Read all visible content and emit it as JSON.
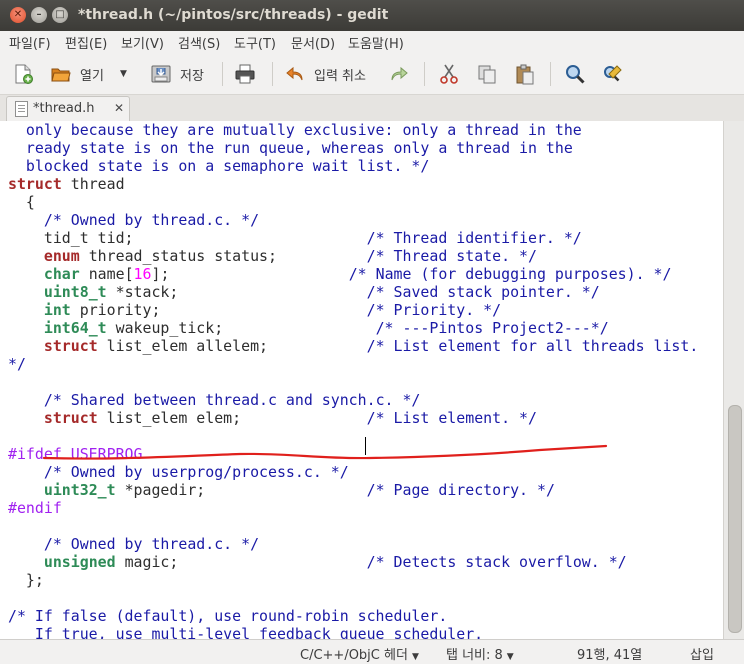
{
  "window": {
    "title": "*thread.h (~/pintos/src/threads) - gedit"
  },
  "menu": [
    "파일(F)",
    "편집(E)",
    "보기(V)",
    "검색(S)",
    "도구(T)",
    "문서(D)",
    "도움말(H)"
  ],
  "toolbar": {
    "open_label": "열기",
    "save_label": "저장",
    "undo_label": "입력 취소"
  },
  "tab": {
    "label": "*thread.h"
  },
  "code": [
    [
      [
        "c",
        "  only because they are mutually exclusive: only a thread in the"
      ]
    ],
    [
      [
        "c",
        "  ready state is on the run queue, whereas only a thread in the"
      ]
    ],
    [
      [
        "c",
        "  blocked state is on a semaphore wait list. */"
      ]
    ],
    [
      [
        "k",
        "struct"
      ],
      [
        "p",
        " thread"
      ]
    ],
    [
      [
        "p",
        "  {"
      ]
    ],
    [
      [
        "p",
        "    "
      ],
      [
        "c",
        "/* Owned by thread.c. */"
      ]
    ],
    [
      [
        "p",
        "    tid_t tid;                          "
      ],
      [
        "c",
        "/* Thread identifier. */"
      ]
    ],
    [
      [
        "p",
        "    "
      ],
      [
        "k",
        "enum"
      ],
      [
        "p",
        " thread_status status;          "
      ],
      [
        "c",
        "/* Thread state. */"
      ]
    ],
    [
      [
        "p",
        "    "
      ],
      [
        "t",
        "char"
      ],
      [
        "p",
        " name["
      ],
      [
        "n",
        "16"
      ],
      [
        "p",
        "];                    "
      ],
      [
        "c",
        "/* Name (for debugging purposes). */"
      ]
    ],
    [
      [
        "p",
        "    "
      ],
      [
        "t",
        "uint8_t"
      ],
      [
        "p",
        " *stack;                     "
      ],
      [
        "c",
        "/* Saved stack pointer. */"
      ]
    ],
    [
      [
        "p",
        "    "
      ],
      [
        "t",
        "int"
      ],
      [
        "p",
        " priority;                       "
      ],
      [
        "c",
        "/* Priority. */"
      ]
    ],
    [
      [
        "p",
        "    "
      ],
      [
        "t",
        "int64_t"
      ],
      [
        "p",
        " wakeup_tick;                 "
      ],
      [
        "c",
        "/* ---Pintos Project2---*/"
      ]
    ],
    [
      [
        "p",
        "    "
      ],
      [
        "k",
        "struct"
      ],
      [
        "p",
        " list_elem allelem;           "
      ],
      [
        "c",
        "/* List element for all threads list."
      ]
    ],
    [
      [
        "c",
        "*/"
      ]
    ],
    [
      [
        "p",
        ""
      ]
    ],
    [
      [
        "p",
        "    "
      ],
      [
        "c",
        "/* Shared between thread.c and synch.c. */"
      ]
    ],
    [
      [
        "p",
        "    "
      ],
      [
        "k",
        "struct"
      ],
      [
        "p",
        " list_elem elem;              "
      ],
      [
        "c",
        "/* List element. */"
      ]
    ],
    [
      [
        "p",
        ""
      ]
    ],
    [
      [
        "pp",
        "#ifdef USERPROG"
      ]
    ],
    [
      [
        "p",
        "    "
      ],
      [
        "c",
        "/* Owned by userprog/process.c. */"
      ]
    ],
    [
      [
        "p",
        "    "
      ],
      [
        "t",
        "uint32_t"
      ],
      [
        "p",
        " *pagedir;                  "
      ],
      [
        "c",
        "/* Page directory. */"
      ]
    ],
    [
      [
        "pp",
        "#endif"
      ]
    ],
    [
      [
        "p",
        ""
      ]
    ],
    [
      [
        "p",
        "    "
      ],
      [
        "c",
        "/* Owned by thread.c. */"
      ]
    ],
    [
      [
        "p",
        "    "
      ],
      [
        "t",
        "unsigned"
      ],
      [
        "p",
        " magic;                     "
      ],
      [
        "c",
        "/* Detects stack overflow. */"
      ]
    ],
    [
      [
        "p",
        "  };"
      ]
    ],
    [
      [
        "p",
        ""
      ]
    ],
    [
      [
        "c",
        "/* If false (default), use round-robin scheduler."
      ]
    ],
    [
      [
        "c",
        "   If true, use multi-level feedback queue scheduler."
      ]
    ]
  ],
  "status": {
    "language": "C/C++/ObjC 헤더",
    "tab_width": "탭 너비: 8",
    "position": "91행, 41열",
    "mode": "삽입"
  },
  "annotation_color": "#e0201c"
}
